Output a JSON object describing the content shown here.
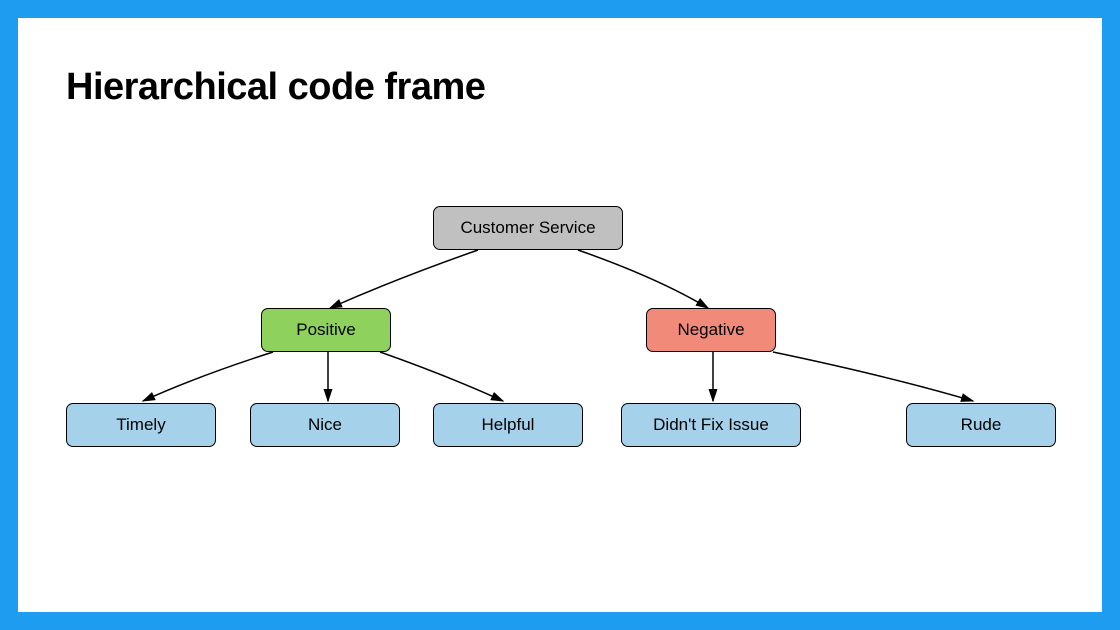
{
  "title": "Hierarchical code frame",
  "root": {
    "label": "Customer Service"
  },
  "positive": {
    "label": "Positive"
  },
  "negative": {
    "label": "Negative"
  },
  "leaves": {
    "timely": "Timely",
    "nice": "Nice",
    "helpful": "Helpful",
    "didnt": "Didn't Fix Issue",
    "rude": "Rude"
  },
  "colors": {
    "border": "#1e9cf0",
    "root": "#c0c0c0",
    "positive": "#8ed15c",
    "negative": "#f28a7a",
    "leaf": "#a6d1eb"
  }
}
